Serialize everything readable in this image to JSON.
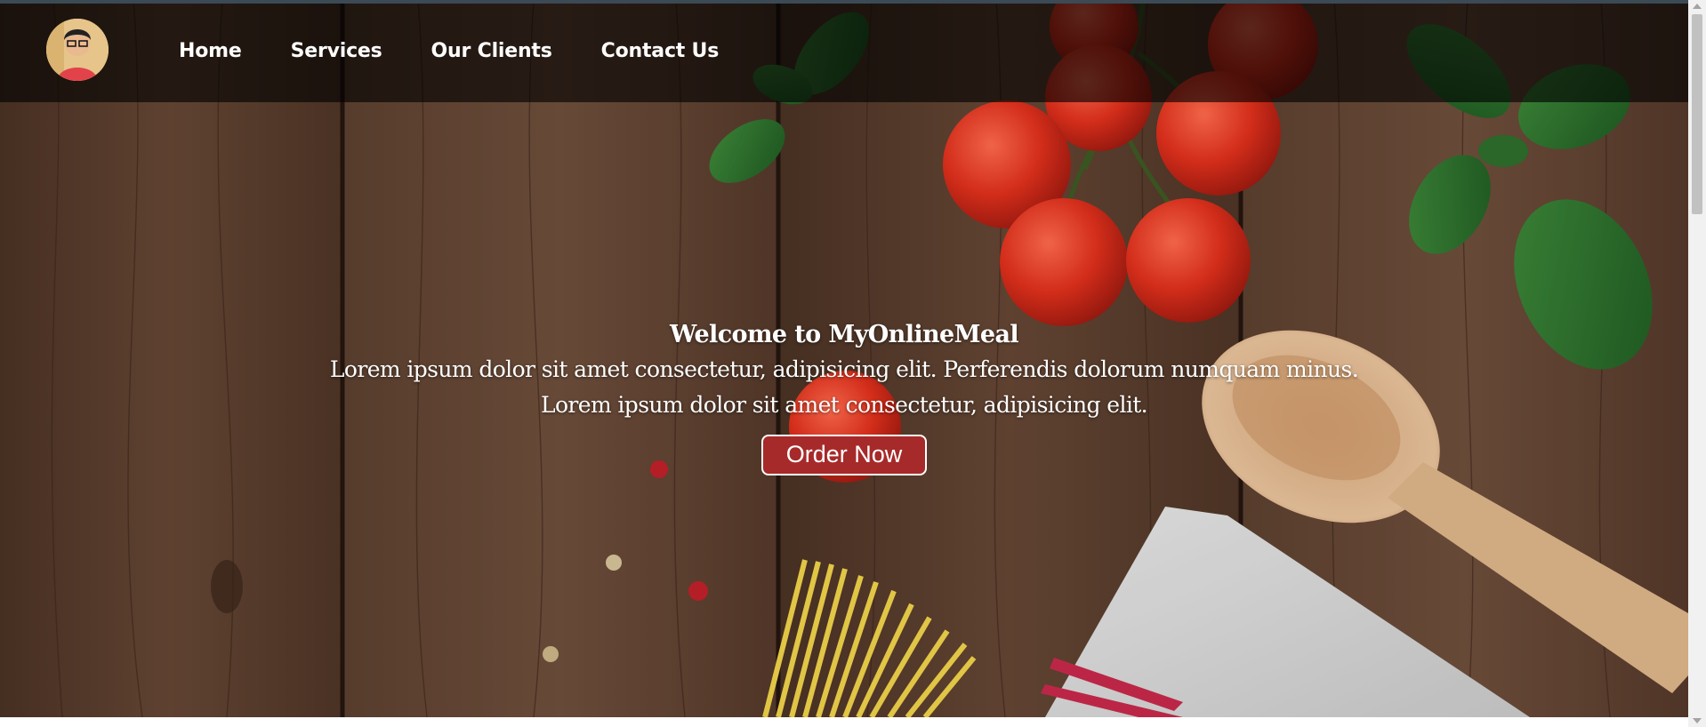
{
  "nav": {
    "avatar_alt": "profile avatar",
    "links": [
      "Home",
      "Services",
      "Our Clients",
      "Contact Us"
    ]
  },
  "hero": {
    "title": "Welcome to MyOnlineMeal",
    "line1": "Lorem ipsum dolor sit amet consectetur, adipisicing elit. Perferendis dolorum numquam minus.",
    "line2": "Lorem ipsum dolor sit amet consectetur, adipisicing elit.",
    "cta": "Order Now"
  },
  "colors": {
    "navbar_overlay": "rgba(0,0,0,0.62)",
    "button_bg": "#a62a2a",
    "wood": "#5a3d2c"
  }
}
